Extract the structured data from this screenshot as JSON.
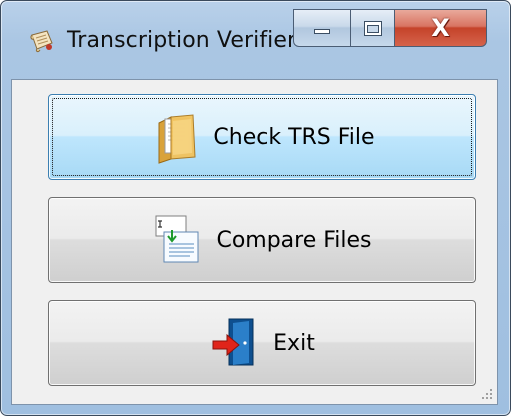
{
  "window": {
    "title": "Transcription Verifier",
    "icon": "scroll-icon",
    "caption_buttons": {
      "minimize_icon": "minimize-icon",
      "maximize_icon": "maximize-icon",
      "close_label": "X"
    }
  },
  "buttons": [
    {
      "label": "Check TRS File",
      "icon": "folder-document-icon",
      "focused": true
    },
    {
      "label": "Compare Files",
      "icon": "compare-documents-icon",
      "focused": false
    },
    {
      "label": "Exit",
      "icon": "exit-door-icon",
      "focused": false
    }
  ],
  "colors": {
    "title_bar": "#aac6e3",
    "close_button": "#c5432a",
    "focused_button_border": "#3c7fb1",
    "client_background": "#f0f0f0"
  }
}
